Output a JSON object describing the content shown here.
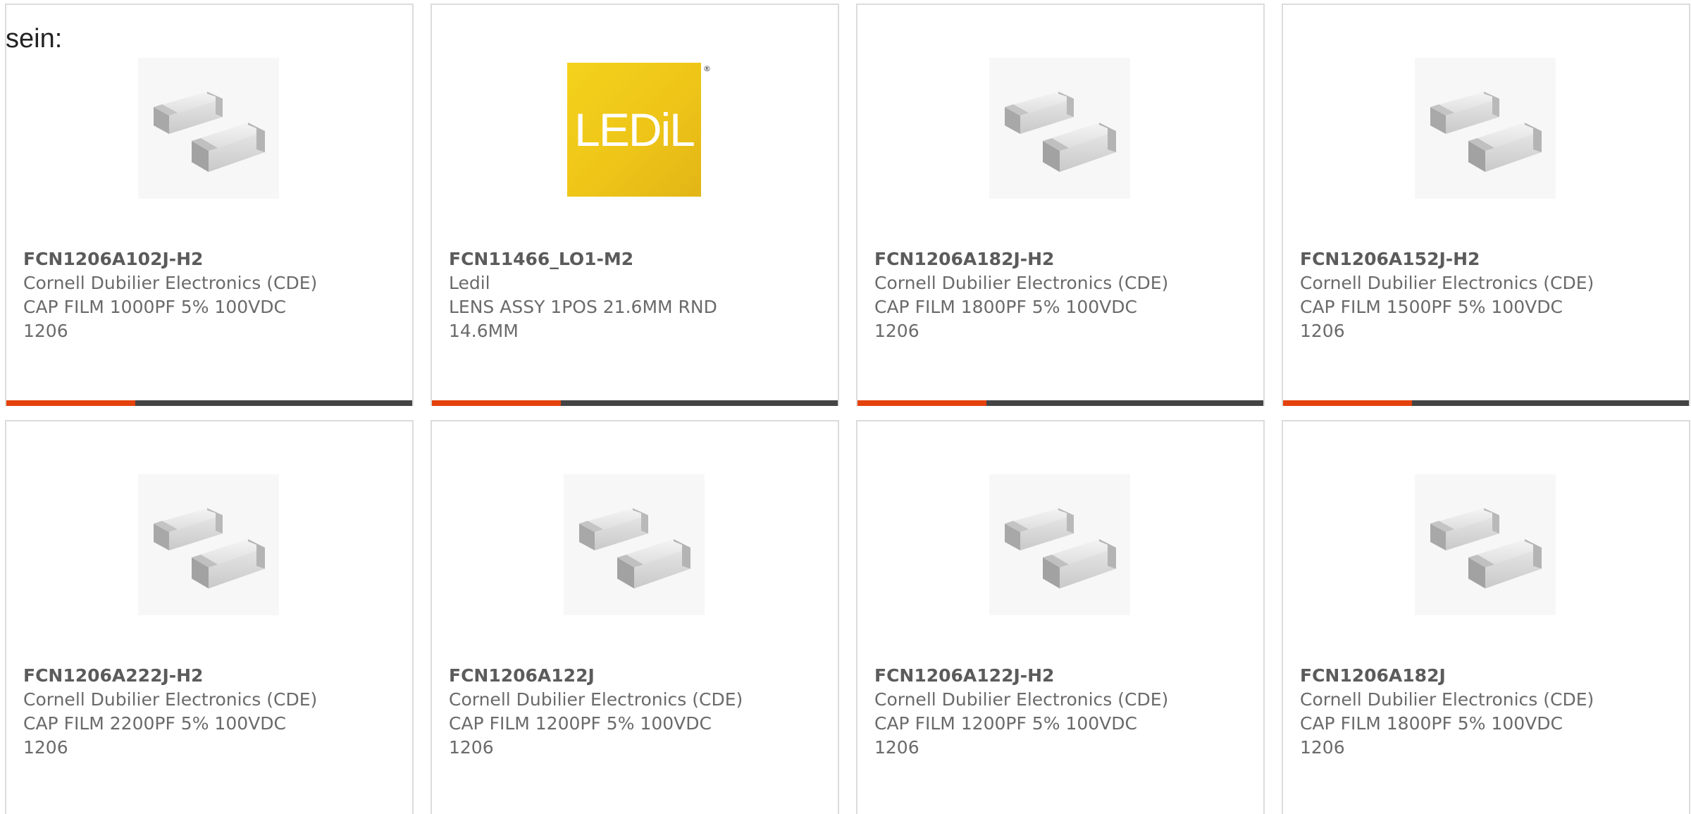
{
  "intro_text": "sein:",
  "colors": {
    "accent": "#e4410c",
    "bar": "#444444",
    "logo_yellow": "#f0c818"
  },
  "products": [
    {
      "part": "FCN1206A102J-H2",
      "manufacturer": "Cornell Dubilier Electronics (CDE)",
      "desc_line1": "CAP FILM 1000PF 5% 100VDC",
      "desc_line2": "1206",
      "image": "smd-capacitor-image"
    },
    {
      "part": "FCN11466_LO1-M2",
      "manufacturer": "Ledil",
      "desc_line1": "LENS ASSY 1POS 21.6MM RND",
      "desc_line2": "14.6MM",
      "image": "ledil-logo",
      "logo_text": "LEDiL",
      "logo_mark": "®"
    },
    {
      "part": "FCN1206A182J-H2",
      "manufacturer": "Cornell Dubilier Electronics (CDE)",
      "desc_line1": "CAP FILM 1800PF 5% 100VDC",
      "desc_line2": "1206",
      "image": "smd-capacitor-image"
    },
    {
      "part": "FCN1206A152J-H2",
      "manufacturer": "Cornell Dubilier Electronics (CDE)",
      "desc_line1": "CAP FILM 1500PF 5% 100VDC",
      "desc_line2": "1206",
      "image": "smd-capacitor-image"
    },
    {
      "part": "FCN1206A222J-H2",
      "manufacturer": "Cornell Dubilier Electronics (CDE)",
      "desc_line1": "CAP FILM 2200PF 5% 100VDC",
      "desc_line2": "1206",
      "image": "smd-capacitor-image"
    },
    {
      "part": "FCN1206A122J",
      "manufacturer": "Cornell Dubilier Electronics (CDE)",
      "desc_line1": "CAP FILM 1200PF 5% 100VDC",
      "desc_line2": "1206",
      "image": "smd-capacitor-image"
    },
    {
      "part": "FCN1206A122J-H2",
      "manufacturer": "Cornell Dubilier Electronics (CDE)",
      "desc_line1": "CAP FILM 1200PF 5% 100VDC",
      "desc_line2": "1206",
      "image": "smd-capacitor-image"
    },
    {
      "part": "FCN1206A182J",
      "manufacturer": "Cornell Dubilier Electronics (CDE)",
      "desc_line1": "CAP FILM 1800PF 5% 100VDC",
      "desc_line2": "1206",
      "image": "smd-capacitor-image"
    }
  ]
}
